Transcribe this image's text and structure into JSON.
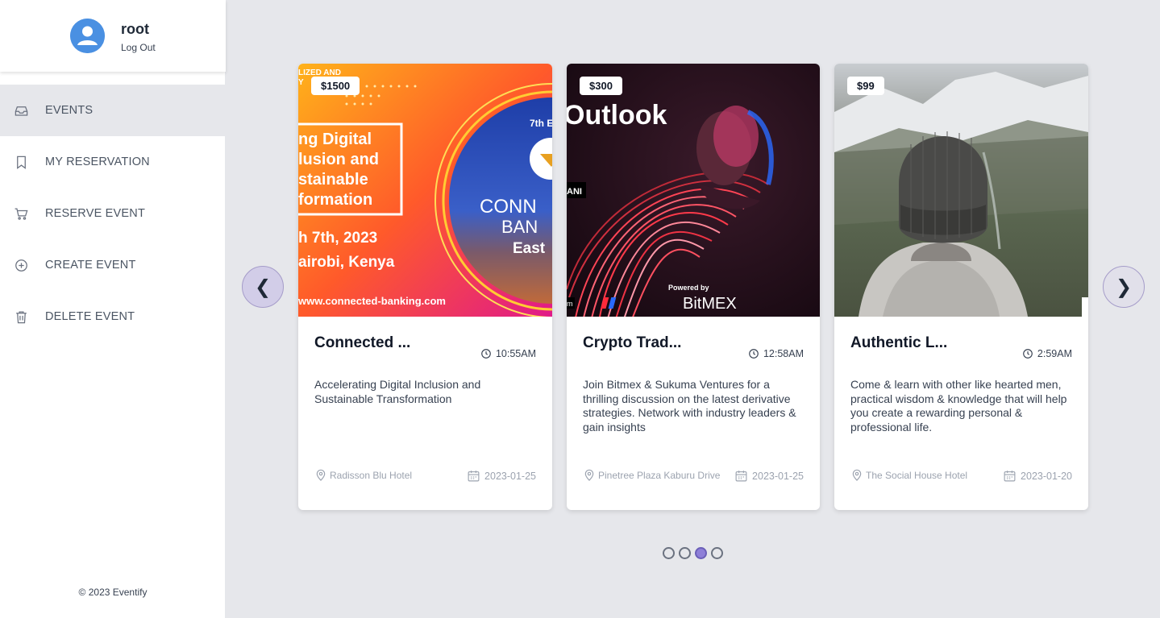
{
  "user": {
    "name": "root",
    "logout_label": "Log Out"
  },
  "nav": [
    {
      "label": "EVENTS",
      "icon": "inbox-icon",
      "active": true
    },
    {
      "label": "MY RESERVATION",
      "icon": "bookmark-icon",
      "active": false
    },
    {
      "label": "RESERVE EVENT",
      "icon": "cart-icon",
      "active": false
    },
    {
      "label": "CREATE EVENT",
      "icon": "plus-circle-icon",
      "active": false
    },
    {
      "label": "DELETE EVENT",
      "icon": "trash-icon",
      "active": false
    }
  ],
  "footer": "© 2023 Eventify",
  "carousel": {
    "prev_label": "❮",
    "next_label": "❯",
    "page_count": 4,
    "active_page": 3
  },
  "events": [
    {
      "price": "$1500",
      "title": "Connected ...",
      "time": "10:55AM",
      "description": "Accelerating Digital Inclusion and Sustainable Transformation",
      "location": "Radisson Blu Hotel",
      "date": "2023-01-25",
      "image": {
        "line1": "ng Digital",
        "line2": "lusion and",
        "line3": "stainable",
        "line4": "formation",
        "date_text": "h 7th, 2023",
        "city_text": "airobi, Kenya",
        "url_text": "www.connected-banking.com",
        "edition_text": "7th E",
        "brand_text1": "CONN",
        "brand_text2": "BAN",
        "brand_text3": "East",
        "corner_text1": "LIZED AND",
        "corner_text2": "Y"
      }
    },
    {
      "price": "$300",
      "title": "Crypto Trad...",
      "time": "12:58AM",
      "description": "Join Bitmex & Sukuma Ventures for a thrilling discussion on the latest derivative strategies. Network with industry leaders & gain insights",
      "location": "Pinetree Plaza Kaburu Drive",
      "date": "2023-01-25",
      "image": {
        "headline": "Outlook",
        "tag": "ANI",
        "powered_by": "Powered by",
        "brand": "BitMEX",
        "corner": "m"
      }
    },
    {
      "price": "$99",
      "title": "Authentic L...",
      "time": "2:59AM",
      "description": "Come & learn with other like hearted men, practical wisdom & knowledge that will help you create a rewarding personal & professional life.",
      "location": "The Social House Hotel",
      "date": "2023-01-20",
      "image": {}
    }
  ]
}
